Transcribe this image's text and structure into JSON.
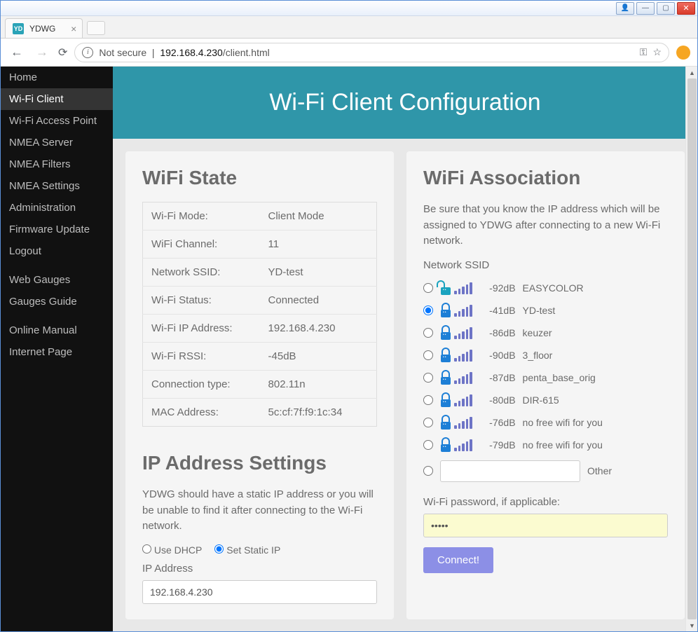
{
  "chrome": {
    "tab_title": "YDWG",
    "url_prefix": "Not secure",
    "url_host": "192.168.4.230",
    "url_path": "/client.html"
  },
  "sidebar": {
    "groups": [
      [
        "Home",
        "Wi-Fi Client",
        "Wi-Fi Access Point",
        "NMEA Server",
        "NMEA Filters",
        "NMEA Settings",
        "Administration",
        "Firmware Update",
        "Logout"
      ],
      [
        "Web Gauges",
        "Gauges Guide"
      ],
      [
        "Online Manual",
        "Internet Page"
      ]
    ],
    "active": "Wi-Fi Client"
  },
  "page": {
    "title": "Wi-Fi Client Configuration"
  },
  "wifi_state": {
    "heading": "WiFi State",
    "rows": [
      {
        "label": "Wi-Fi Mode:",
        "value": "Client Mode"
      },
      {
        "label": "WiFi Channel:",
        "value": "11"
      },
      {
        "label": "Network SSID:",
        "value": "YD-test"
      },
      {
        "label": "Wi-Fi Status:",
        "value": "Connected"
      },
      {
        "label": "Wi-Fi IP Address:",
        "value": "192.168.4.230"
      },
      {
        "label": "Wi-Fi RSSI:",
        "value": "-45dB"
      },
      {
        "label": "Connection type:",
        "value": "802.11n"
      },
      {
        "label": "MAC Address:",
        "value": "5c:cf:7f:f9:1c:34"
      }
    ]
  },
  "ip_settings": {
    "heading": "IP Address Settings",
    "intro": "YDWG should have a static IP address or you will be unable to find it after connecting to the Wi-Fi network.",
    "dhcp_label": "Use DHCP",
    "static_label": "Set Static IP",
    "selected": "static",
    "ip_label": "IP Address",
    "ip_value": "192.168.4.230"
  },
  "association": {
    "heading": "WiFi Association",
    "intro": "Be sure that you know the IP address which will be assigned to YDWG after connecting to a new Wi-Fi network.",
    "ssid_label": "Network SSID",
    "networks": [
      {
        "security": "open",
        "rssi": "-92dB",
        "ssid": "EASYCOLOR",
        "selected": false
      },
      {
        "security": "closed",
        "rssi": "-41dB",
        "ssid": "YD-test",
        "selected": true
      },
      {
        "security": "closed",
        "rssi": "-86dB",
        "ssid": "keuzer",
        "selected": false
      },
      {
        "security": "closed",
        "rssi": "-90dB",
        "ssid": "3_floor",
        "selected": false
      },
      {
        "security": "closed",
        "rssi": "-87dB",
        "ssid": "penta_base_orig",
        "selected": false
      },
      {
        "security": "closed",
        "rssi": "-80dB",
        "ssid": "DIR-615",
        "selected": false
      },
      {
        "security": "closed",
        "rssi": "-76dB",
        "ssid": "no free wifi for you",
        "selected": false
      },
      {
        "security": "closed",
        "rssi": "-79dB",
        "ssid": "no free wifi for you",
        "selected": false
      }
    ],
    "other_label": "Other",
    "pwd_label": "Wi-Fi password, if applicable:",
    "pwd_value": "•••••",
    "connect_label": "Connect!"
  }
}
